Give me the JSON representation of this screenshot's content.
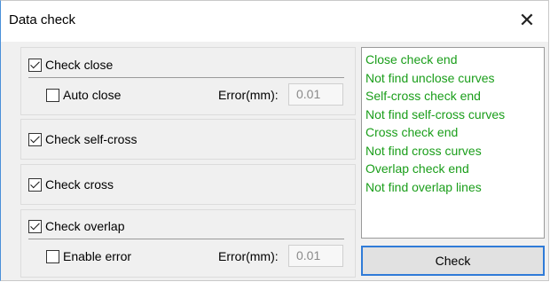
{
  "window": {
    "title": "Data check",
    "close_glyph": "✕"
  },
  "groups": {
    "close": {
      "check_label": "Check close",
      "checked": true,
      "auto_close_label": "Auto close",
      "auto_close_checked": false,
      "error_label": "Error(mm):",
      "error_value": "0.01"
    },
    "self_cross": {
      "check_label": "Check self-cross",
      "checked": true
    },
    "cross": {
      "check_label": "Check cross",
      "checked": true
    },
    "overlap": {
      "check_label": "Check overlap",
      "checked": true,
      "enable_error_label": "Enable error",
      "enable_error_checked": false,
      "error_label": "Error(mm):",
      "error_value": "0.01"
    }
  },
  "log": {
    "lines": [
      "Close check end",
      "Not find unclose curves",
      "Self-cross check end",
      "Not find self-cross curves",
      "Cross check end",
      "Not find cross curves",
      "Overlap check end",
      "Not find overlap lines"
    ],
    "text_color": "#1a9e1a"
  },
  "buttons": {
    "check_label": "Check"
  },
  "colors": {
    "accent": "#2f7bd8"
  }
}
